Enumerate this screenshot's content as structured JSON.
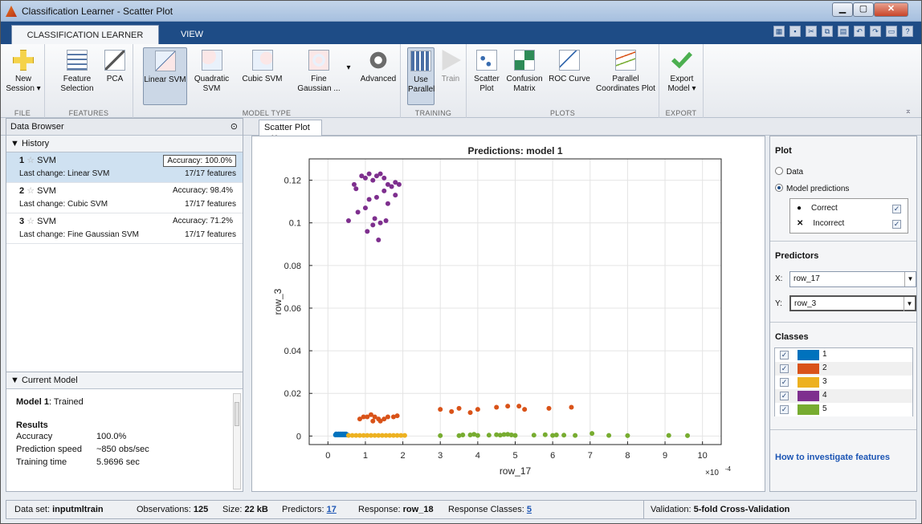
{
  "window": {
    "title": "Classification Learner - Scatter Plot"
  },
  "tabs": {
    "main": "CLASSIFICATION LEARNER",
    "view": "VIEW"
  },
  "ribbon": {
    "new_session": "New Session ▾",
    "feature_selection": "Feature Selection",
    "pca": "PCA",
    "linear_svm": "Linear SVM",
    "quadratic_svm": "Quadratic SVM",
    "cubic_svm": "Cubic SVM",
    "fine_gaussian": "Fine Gaussian ...",
    "advanced": "Advanced",
    "use_parallel": "Use Parallel",
    "train": "Train",
    "scatter_plot": "Scatter Plot",
    "confusion_matrix": "Confusion Matrix",
    "roc_curve": "ROC Curve",
    "parallel_coordinates": "Parallel Coordinates Plot",
    "export_model": "Export Model ▾",
    "groups": {
      "file": "FILE",
      "features": "FEATURES",
      "model_type": "MODEL TYPE",
      "training": "TRAINING",
      "plots": "PLOTS",
      "export": "EXPORT"
    }
  },
  "data_browser": {
    "title": "Data Browser",
    "history_label": "History",
    "current_model_label": "Current Model"
  },
  "history": [
    {
      "num": "1",
      "name": "SVM",
      "accuracy": "Accuracy: 100.0%",
      "change": "Last change: Linear SVM",
      "features": "17/17 features"
    },
    {
      "num": "2",
      "name": "SVM",
      "accuracy": "Accuracy: 98.4%",
      "change": "Last change: Cubic SVM",
      "features": "17/17 features"
    },
    {
      "num": "3",
      "name": "SVM",
      "accuracy": "Accuracy: 71.2%",
      "change": "Last change: Fine Gaussian SVM",
      "features": "17/17 features"
    }
  ],
  "current_model": {
    "title_bold": "Model 1",
    "title_rest": ": Trained",
    "results": "Results",
    "rows": [
      {
        "k": "Accuracy",
        "v": "100.0%"
      },
      {
        "k": "Prediction speed",
        "v": "~850 obs/sec"
      },
      {
        "k": "Training time",
        "v": "5.9696 sec"
      }
    ]
  },
  "doc_tab": "Scatter Plot",
  "plot_panel": {
    "plot_title": "Plot",
    "data_option": "Data",
    "predictions_option": "Model predictions",
    "correct": "Correct",
    "incorrect": "Incorrect",
    "predictors_title": "Predictors",
    "x_label": "X:",
    "x_value": "row_17",
    "y_label": "Y:",
    "y_value": "row_3",
    "classes_title": "Classes",
    "link": "How to investigate features"
  },
  "classes": [
    {
      "label": "1",
      "color": "#0072bd"
    },
    {
      "label": "2",
      "color": "#d95319"
    },
    {
      "label": "3",
      "color": "#edb120"
    },
    {
      "label": "4",
      "color": "#7e2f8e"
    },
    {
      "label": "5",
      "color": "#77ac30"
    }
  ],
  "status": {
    "dataset_label": "Data set: ",
    "dataset": "inputmltrain",
    "obs_label": "Observations: ",
    "obs": "125",
    "size_label": "Size: ",
    "size": "22 kB",
    "pred_label": "Predictors: ",
    "pred": "17",
    "resp_label": "Response: ",
    "resp": "row_18",
    "rc_label": "Response Classes: ",
    "rc": "5",
    "val_label": "Validation: ",
    "val": "5-fold Cross-Validation"
  },
  "chart_data": {
    "type": "scatter",
    "title": "Predictions: model 1",
    "xlabel": "row_17",
    "ylabel": "row_3",
    "x_exponent_label": "×10",
    "x_exponent_power": "-4",
    "xlim": [
      -0.5,
      10.5
    ],
    "ylim": [
      -0.004,
      0.13
    ],
    "xticks": [
      "0",
      "1",
      "2",
      "3",
      "4",
      "5",
      "6",
      "7",
      "8",
      "9",
      "10"
    ],
    "yticks": [
      "0",
      "0.02",
      "0.04",
      "0.06",
      "0.08",
      "0.1",
      "0.12"
    ],
    "grid": true,
    "series": [
      {
        "name": "1",
        "color": "#0072bd",
        "x": [
          0.2,
          0.25,
          0.3,
          0.35,
          0.4,
          0.45,
          0.5,
          0.22,
          0.28,
          0.33,
          0.38,
          0.43,
          0.48,
          0.52,
          0.27
        ],
        "y": [
          0.0005,
          0.0005,
          0.0005,
          0.0005,
          0.0005,
          0.0005,
          0.0005,
          0.001,
          0.001,
          0.001,
          0.001,
          0.001,
          0.001,
          0.0005,
          0.0008
        ]
      },
      {
        "name": "2",
        "color": "#d95319",
        "x": [
          0.85,
          0.95,
          1.05,
          1.15,
          1.25,
          1.35,
          1.5,
          1.6,
          1.75,
          1.85,
          1.4,
          1.2,
          3.0,
          3.3,
          3.5,
          3.8,
          4.0,
          4.5,
          4.8,
          5.1,
          5.25,
          5.9,
          6.5
        ],
        "y": [
          0.008,
          0.009,
          0.009,
          0.01,
          0.009,
          0.008,
          0.008,
          0.009,
          0.009,
          0.0095,
          0.007,
          0.007,
          0.0125,
          0.0115,
          0.013,
          0.011,
          0.0125,
          0.0135,
          0.014,
          0.014,
          0.0125,
          0.013,
          0.0135
        ]
      },
      {
        "name": "3",
        "color": "#edb120",
        "x": [
          0.55,
          0.65,
          0.75,
          0.85,
          0.95,
          1.05,
          1.15,
          1.25,
          1.35,
          1.45,
          1.55,
          1.65,
          1.75,
          1.85,
          1.95,
          2.05
        ],
        "y": [
          0.0003,
          0.0003,
          0.0003,
          0.0003,
          0.0003,
          0.0003,
          0.0003,
          0.0003,
          0.0003,
          0.0003,
          0.0003,
          0.0003,
          0.0003,
          0.0003,
          0.0003,
          0.0003
        ]
      },
      {
        "name": "4",
        "color": "#7e2f8e",
        "x": [
          0.55,
          0.7,
          0.75,
          0.9,
          1.0,
          1.1,
          1.2,
          1.3,
          1.4,
          1.5,
          1.6,
          1.7,
          1.8,
          1.9,
          1.1,
          1.3,
          1.5,
          1.6,
          1.0,
          1.2,
          1.4,
          0.8,
          1.05,
          1.25,
          1.35,
          1.55,
          1.8
        ],
        "y": [
          0.101,
          0.118,
          0.116,
          0.122,
          0.121,
          0.123,
          0.12,
          0.122,
          0.123,
          0.121,
          0.118,
          0.117,
          0.119,
          0.118,
          0.111,
          0.112,
          0.115,
          0.109,
          0.107,
          0.099,
          0.1,
          0.105,
          0.096,
          0.102,
          0.092,
          0.101,
          0.113
        ]
      },
      {
        "name": "5",
        "color": "#77ac30",
        "x": [
          3.0,
          3.5,
          3.6,
          3.8,
          3.9,
          4.0,
          4.3,
          4.5,
          4.6,
          4.7,
          4.8,
          4.9,
          5.0,
          5.5,
          5.8,
          6.0,
          6.1,
          6.3,
          6.6,
          7.05,
          7.5,
          8.0,
          9.1,
          9.6
        ],
        "y": [
          0.0002,
          0.0002,
          0.0005,
          0.0005,
          0.0008,
          0.0003,
          0.0004,
          0.0006,
          0.0004,
          0.0007,
          0.0008,
          0.0005,
          0.0003,
          0.0004,
          0.0006,
          0.0003,
          0.0005,
          0.0004,
          0.0003,
          0.0012,
          0.0003,
          0.0002,
          0.0003,
          0.0002
        ]
      }
    ]
  }
}
